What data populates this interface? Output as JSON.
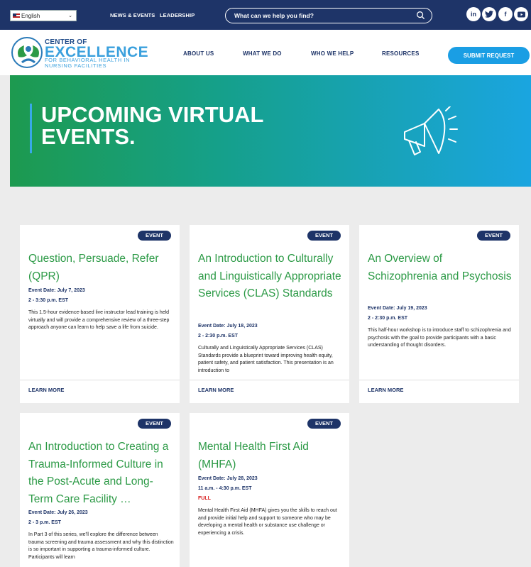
{
  "top_bar": {
    "language": "English",
    "links": [
      "NEWS & EVENTS",
      "LEADERSHIP"
    ],
    "search_placeholder": "What can we help you find?",
    "social": [
      "in",
      "t",
      "f",
      "yt"
    ]
  },
  "header": {
    "logo_line1": "CENTER OF",
    "logo_line2": "EXCELLENCE",
    "logo_line3": "FOR BEHAVIORAL HEALTH IN NURSING FACILITIES",
    "nav": [
      "ABOUT US",
      "WHAT WE DO",
      "WHO WE HELP",
      "RESOURCES"
    ],
    "cta": "SUBMIT REQUEST"
  },
  "hero": {
    "title": "UPCOMING VIRTUAL EVENTS."
  },
  "events": [
    {
      "badge": "EVENT",
      "title": "Question, Persuade, Refer (QPR)",
      "date": "Event Date: July 7, 2023",
      "time": "2 - 3:30 p.m. EST",
      "status": "",
      "description": "This 1.5-hour evidence-based live instructor lead training is held virtually and will provide a comprehensive review of a three-step approach anyone can learn to help save a life from suicide.",
      "link": "LEARN MORE"
    },
    {
      "badge": "EVENT",
      "title": "An Introduction to Culturally and Linguistically Appropriate Services (CLAS) Standards",
      "date": "Event Date: July 18, 2023",
      "time": "2 - 2:30 p.m. EST",
      "status": "",
      "description": "Culturally and Linguistically Appropriate Services (CLAS) Standards provide a blueprint toward improving health equity, patient safety, and patient satisfaction. This presentation is an introduction to",
      "link": "LEARN MORE"
    },
    {
      "badge": "EVENT",
      "title": "An Overview of Schizophrenia and Psychosis",
      "date": "Event Date: July 19, 2023",
      "time": "2 - 2:30 p.m. EST",
      "status": "",
      "description": "This half-hour workshop is to introduce staff to schizophrenia and psychosis with the goal to provide participants with a basic understanding of thought disorders.",
      "link": "LEARN MORE"
    },
    {
      "badge": "EVENT",
      "title": "An Introduction to Creating a Trauma-Informed Culture in the Post-Acute and Long-Term Care Facility …",
      "date": "Event Date: July 26, 2023",
      "time": "2 - 3 p.m. EST",
      "status": "",
      "description": "In Part 3 of this series, we'll explore the difference between trauma screening and trauma assessment and why this distinction is so important in supporting a trauma-informed culture. Participants will learn",
      "link": ""
    },
    {
      "badge": "EVENT",
      "title": "Mental Health First Aid (MHFA)",
      "date": "Event Date: July 28, 2023",
      "time": "11 a.m. - 4:30 p.m. EST",
      "status": "FULL",
      "description": "Mental Health First Aid (MHFA) gives you the skills to reach out and provide initial help and support to someone who may be developing a mental health or substance use challenge or experiencing a crisis.",
      "link": ""
    }
  ]
}
